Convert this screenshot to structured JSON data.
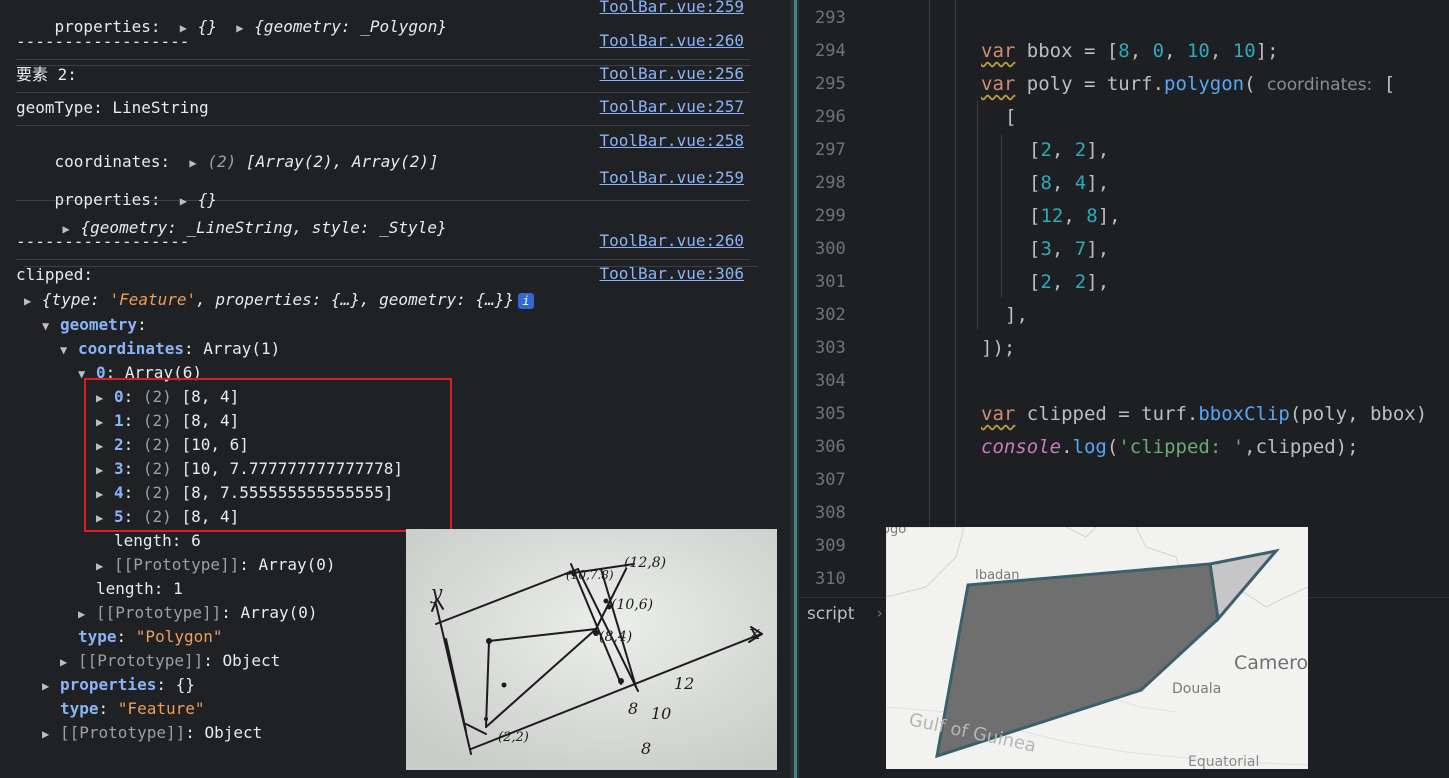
{
  "console": {
    "rows": [
      {
        "text_prefix": "properties:",
        "text_obj": "{}",
        "text_obj2": "{geometry: _Polygon}",
        "src": "ToolBar.vue:259"
      },
      {
        "text": "------------------",
        "src": "ToolBar.vue:260"
      },
      {
        "text": "要素 2:",
        "src": "ToolBar.vue:256"
      },
      {
        "text": "geomType: LineString",
        "src": "ToolBar.vue:257"
      },
      {
        "text_prefix": "coordinates:",
        "text_obj": "(2) [Array(2), Array(2)]",
        "src": "ToolBar.vue:258"
      },
      {
        "text_prefix": "properties:",
        "text_obj": "{}",
        "text_obj2": "{geometry: _LineString, style: _Style}",
        "src": "ToolBar.vue:259"
      },
      {
        "text": "------------------",
        "src": "ToolBar.vue:260"
      },
      {
        "text": "clipped:",
        "src": "ToolBar.vue:306"
      }
    ],
    "tree": {
      "root_summary_a": "{type: ",
      "root_type": "'Feature'",
      "root_summary_b": ", properties: {…}, geometry: {…}}",
      "info": "i",
      "geometry": "geometry",
      "coordinates": "coordinates",
      "coordinates_val": "Array(1)",
      "idx0": "0",
      "idx0_val": "Array(6)",
      "points": [
        {
          "idx": "0",
          "count": "(2)",
          "val": "[8, 4]"
        },
        {
          "idx": "1",
          "count": "(2)",
          "val": "[8, 4]"
        },
        {
          "idx": "2",
          "count": "(2)",
          "val": "[10, 6]"
        },
        {
          "idx": "3",
          "count": "(2)",
          "val": "[10, 7.777777777777778]"
        },
        {
          "idx": "4",
          "count": "(2)",
          "val": "[8, 7.555555555555555]"
        },
        {
          "idx": "5",
          "count": "(2)",
          "val": "[8, 4]"
        }
      ],
      "length_inner": "length: 6",
      "proto_inner": "[[Prototype]]",
      "proto_inner_val": "Array(0)",
      "length_outer": "length: 1",
      "proto_outer": "[[Prototype]]",
      "proto_outer_val": "Array(0)",
      "type_key": "type",
      "type_val": "\"Polygon\"",
      "proto_geom": "[[Prototype]]",
      "proto_geom_val": "Object",
      "properties_key": "properties",
      "properties_val": "{}",
      "feature_type_key": "type",
      "feature_type_val": "\"Feature\"",
      "proto_root": "[[Prototype]]",
      "proto_root_val": "Object"
    }
  },
  "editor": {
    "line_numbers": [
      "293",
      "294",
      "295",
      "296",
      "297",
      "298",
      "299",
      "300",
      "301",
      "302",
      "303",
      "304",
      "305",
      "306",
      "307",
      "308",
      "309",
      "310"
    ],
    "code": {
      "l294_kw": "var",
      "l294_rest": " bbox = [",
      "l294_nums": [
        "8",
        "0",
        "10",
        "10"
      ],
      "l294_end": "];",
      "l295_kw": "var",
      "l295_rest": " poly = turf.",
      "l295_fn": "polygon",
      "l295_paren": "(",
      "l295_hint": "coordinates:",
      "l295_bracket": " [",
      "l296": "[",
      "pairs": [
        [
          "2",
          "2"
        ],
        [
          "8",
          "4"
        ],
        [
          "12",
          "8"
        ],
        [
          "3",
          "7"
        ],
        [
          "2",
          "2"
        ]
      ],
      "l302": "],",
      "l303": "]);",
      "l305_kw": "var",
      "l305_rest": " clipped = turf.",
      "l305_fn": "bboxClip",
      "l305_args": "(poly, bbox)",
      "l306_obj": "console",
      "l306_dot": ".",
      "l306_fn": "log",
      "l306_open": "(",
      "l306_str": "'clipped: '",
      "l306_rest": ",clipped);"
    },
    "footer": {
      "label": "script",
      "chevron": "›"
    }
  },
  "photo": {
    "labels": [
      "y",
      "x",
      "(10,7.8)",
      "(12,8)",
      "(10,6)",
      "(8,4)",
      "(2,2)",
      "8",
      "10",
      "12",
      "8"
    ]
  },
  "map": {
    "labels": [
      "Ibadan",
      "Camero",
      "Douala",
      "Equatorial",
      "Gulf of Guinea",
      "ogo"
    ],
    "fill_color": "#6f6f6f",
    "stroke_color": "#3b5f6b"
  }
}
